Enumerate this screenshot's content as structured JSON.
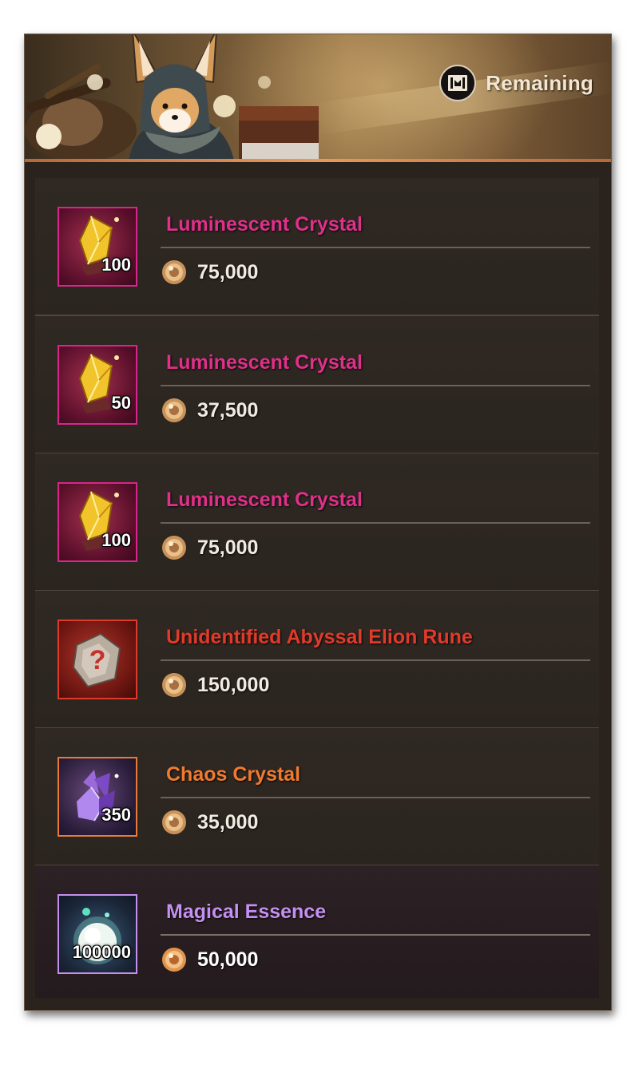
{
  "header": {
    "remaining_label": "Remaining",
    "remaining_icon": "shop-gate-icon"
  },
  "colors": {
    "pink": "#e0308a",
    "red": "#e13a2a",
    "orange": "#f07a30",
    "purple": "#c590f2"
  },
  "items": [
    {
      "name": "Luminescent Crystal",
      "quantity": "100",
      "price": "75,000",
      "icon": "luminescent-crystal-icon",
      "grade": "pink"
    },
    {
      "name": "Luminescent Crystal",
      "quantity": "50",
      "price": "37,500",
      "icon": "luminescent-crystal-icon",
      "grade": "pink"
    },
    {
      "name": "Luminescent Crystal",
      "quantity": "100",
      "price": "75,000",
      "icon": "luminescent-crystal-icon",
      "grade": "pink"
    },
    {
      "name": "Unidentified Abyssal Elion Rune",
      "quantity": "",
      "price": "150,000",
      "icon": "abyssal-rune-icon",
      "grade": "red"
    },
    {
      "name": "Chaos Crystal",
      "quantity": "350",
      "price": "35,000",
      "icon": "chaos-crystal-icon",
      "grade": "orange"
    },
    {
      "name": "Magical Essence",
      "quantity": "100000",
      "price": "50,000",
      "icon": "magical-essence-icon",
      "grade": "purple"
    }
  ]
}
